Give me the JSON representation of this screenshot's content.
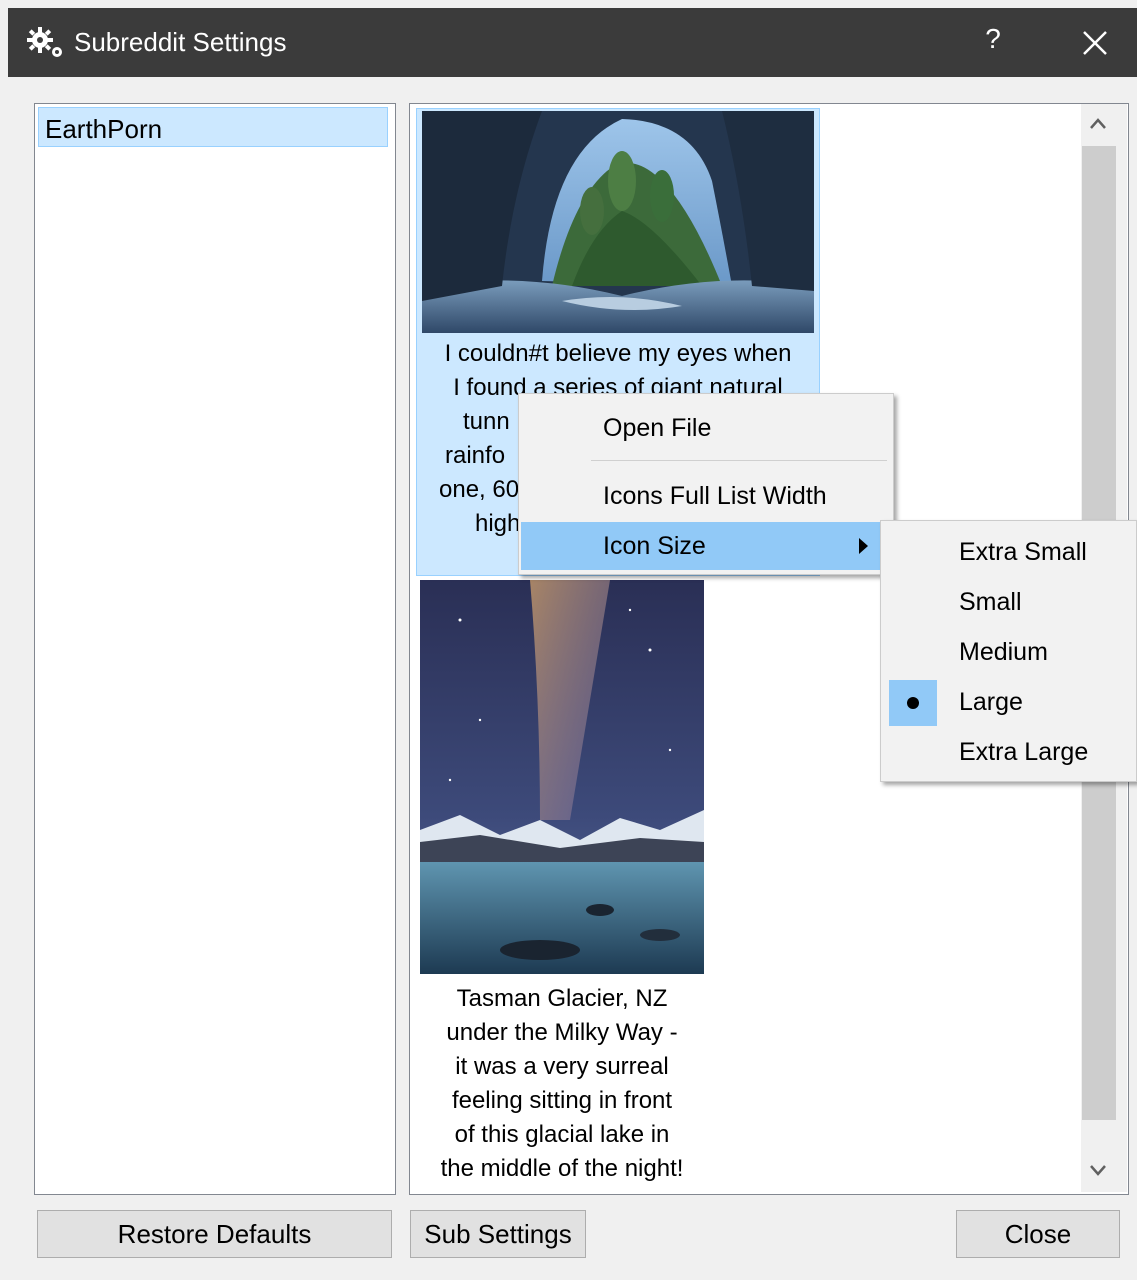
{
  "window": {
    "title": "Subreddit Settings",
    "help_label": "?",
    "title_bar_color": "#3b3b3b"
  },
  "subreddit_list": {
    "items": [
      {
        "label": "EarthPorn",
        "selected": true
      }
    ]
  },
  "posts": [
    {
      "caption_lines": [
        "I couldn#t believe my eyes when",
        "I found a series of giant natural",
        "tunn",
        "rainfo",
        "one, 60",
        "high"
      ],
      "selected": true
    },
    {
      "caption_lines": [
        "Tasman Glacier, NZ",
        "under the Milky Way -",
        "it was a very surreal",
        "feeling sitting in front",
        "of this glacial lake in",
        "the middle of the night!"
      ],
      "selected": false
    }
  ],
  "context_menu": {
    "items": [
      {
        "label": "Open File"
      },
      {
        "label": "Icons Full List Width"
      },
      {
        "label": "Icon Size",
        "has_submenu": true,
        "highlighted": true
      }
    ]
  },
  "icon_size_submenu": {
    "items": [
      {
        "label": "Extra Small",
        "checked": false
      },
      {
        "label": "Small",
        "checked": false
      },
      {
        "label": "Medium",
        "checked": false
      },
      {
        "label": "Large",
        "checked": true
      },
      {
        "label": "Extra Large",
        "checked": false
      }
    ]
  },
  "buttons": {
    "restore_defaults": "Restore Defaults",
    "sub_settings": "Sub Settings",
    "close": "Close"
  },
  "colors": {
    "selection_bg": "#cce8ff",
    "menu_highlight": "#91c9f7"
  }
}
